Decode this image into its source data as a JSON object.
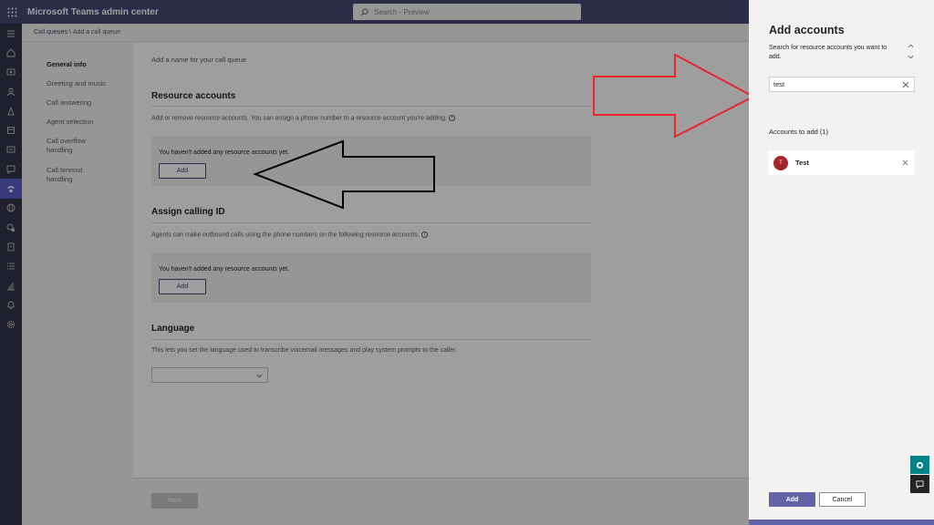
{
  "app": {
    "title": "Microsoft Teams admin center"
  },
  "search": {
    "placeholder": "Search - Preview"
  },
  "breadcrumb": {
    "parent": "Call queues",
    "separator": " \\ ",
    "current": "Add a call queue"
  },
  "subnav": {
    "items": [
      {
        "label": "General info",
        "active": true
      },
      {
        "label": "Greeting and music"
      },
      {
        "label": "Call answering"
      },
      {
        "label": "Agent selection"
      },
      {
        "label": "Call overflow handling"
      },
      {
        "label": "Call timeout handling"
      }
    ]
  },
  "content": {
    "name_hint": "Add a name for your call queue",
    "resource_accounts": {
      "title": "Resource accounts",
      "description": "Add or remove resource accounts. You can assign a phone number to a resource account you're adding.",
      "empty": "You haven't added any resource accounts yet.",
      "add_label": "Add"
    },
    "calling_id": {
      "title": "Assign calling ID",
      "description": "Agents can make outbound calls using the phone numbers on the following resource accounts.",
      "empty": "You haven't added any resource accounts yet.",
      "add_label": "Add"
    },
    "language": {
      "title": "Language",
      "description": "This lets you set the language used to transcribe voicemail messages and play system prompts to the caller.",
      "selected": ""
    },
    "footer": {
      "next_label": "Next"
    }
  },
  "panel": {
    "title": "Add accounts",
    "description": "Search for resource accounts you want to add.",
    "search_value": "test",
    "accounts_to_add_label": "Accounts to add (1)",
    "accounts": [
      {
        "initial": "T",
        "name": "Test",
        "avatar_color": "#a4262c"
      }
    ],
    "add_label": "Add",
    "cancel_label": "Cancel"
  },
  "colors": {
    "brand": "#464775",
    "accent": "#6264a7",
    "rail": "#33344a",
    "annotation_red": "#e8262b",
    "annotation_black": "#000000"
  },
  "rail_icons": [
    "menu-icon",
    "home-icon",
    "teams-icon",
    "users-icon",
    "devices-icon",
    "locations-icon",
    "meetings-icon",
    "messaging-icon",
    "voice-icon",
    "internet-icon",
    "policy-icon",
    "analytics-icon",
    "org-settings-icon",
    "planning-icon",
    "notifications-icon",
    "settings-icon"
  ]
}
